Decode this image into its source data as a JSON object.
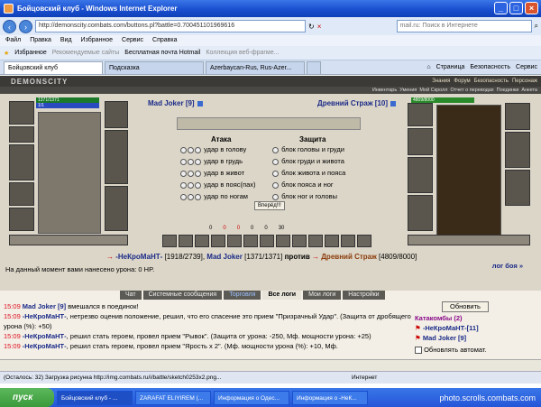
{
  "window": {
    "title": "Бойцовский клуб - Windows Internet Explorer"
  },
  "address": {
    "url": "http://demonscity.combats.com/buttons.pl?battle=0.700451101969616",
    "search_placeholder": "mail.ru: Поиск в Интернете"
  },
  "menu": [
    "Файл",
    "Правка",
    "Вид",
    "Избранное",
    "Сервис",
    "Справка"
  ],
  "favorites": {
    "label": "Избранное",
    "items": [
      "Рекомендуемые сайты",
      "Бесплатная почта Hotmail",
      "Коллекция веб-фрагме..."
    ]
  },
  "tabs": [
    "Бойцовский клуб",
    "Подсказка",
    "Azerbaycan-Rus, Rus-Azer...",
    ""
  ],
  "tools": [
    "Страница",
    "Безопасность",
    "Сервис"
  ],
  "game": {
    "logo": "DEMONSCITY",
    "menu_top": [
      "Знания",
      "Форум",
      "Безопасность",
      "Персонаж"
    ],
    "menu_bottom": [
      "Инвентарь",
      "Умения",
      "Мой Скролл",
      "Отчет о переводах",
      "Поединки",
      "Анкета"
    ],
    "left_hp": "1371/1371",
    "left_mp": "1/1",
    "right_hp": "4809/8000",
    "left_player": {
      "name": "Mad Joker",
      "level": "[9]"
    },
    "right_player": {
      "name": "Древний Страж",
      "level": "[10]"
    },
    "attack_header": "Атака",
    "defense_header": "Защита",
    "attacks": [
      "удар в голову",
      "удар в грудь",
      "удар в живот",
      "удар в пояс(пах)",
      "удар по ногам"
    ],
    "defenses": [
      "блок головы и груди",
      "блок груди и живота",
      "блок живота и пояса",
      "блок пояса и ног",
      "блок ног и головы"
    ],
    "forward_button": "Вперёд!!!",
    "counters": [
      "0",
      "0",
      "0",
      "0",
      "0",
      "30"
    ],
    "versus": {
      "p1": "-НеКроМаНТ-",
      "p1_hp": "[1918/2739]",
      "p2": "Mad Joker",
      "p2_hp": "[1371/1371]",
      "word": "против",
      "p3": "Древний Страж",
      "p3_hp": "[4809/8000]"
    },
    "damage_info": "На данный момент вами нанесено урона: 0 HP.",
    "battle_log": "лог боя »"
  },
  "chat": {
    "tabs": [
      "Чат",
      "Системные сообщения",
      "Торговля",
      "Все логи",
      "Мои логи",
      "Настройки"
    ],
    "messages": [
      {
        "time": "15:09",
        "name": "Mad Joker [9]",
        "text": " вмешался в поединок!"
      },
      {
        "time": "15:09",
        "name": "-НеКроМаНТ-",
        "text": ", нетрезво оценив положение, решил, что его спасение это прием \"Призрачный Удар\". (Защита от дробящего урона (%): +50)"
      },
      {
        "time": "15:09",
        "name": "-НеКроМаНТ-",
        "text": ", решил стать героем, провел прием \"Рывок\". (Защита от урона: -250, Мф. мощности урона: +25)"
      },
      {
        "time": "15:09",
        "name": "-НеКроМаНТ-",
        "text": ", решил стать героем, провел прием \"Ярость х 2\". (Мф. мощности урона (%): +10, Мф."
      }
    ],
    "refresh_button": "Обновить",
    "catacombs": "Катакомбы (2)",
    "members": [
      "-НеКроМаНТ-[11]",
      "Mad Joker [9]"
    ],
    "auto_refresh": "Обновлять автомат."
  },
  "status": {
    "text": "(Осталось: 32) Загрузка рисунка http://img.combats.ru/i/battle/sketch0253x2.png...",
    "zone": "Интернет"
  },
  "taskbar": {
    "start": "пуск",
    "items": [
      "Бойцовский клуб - ...",
      "ZARAFAT ELIYIREM (...",
      "Информация о Одес...",
      "Информация о -НеК..."
    ],
    "watermark": "photo.scrolls.combats.com"
  }
}
